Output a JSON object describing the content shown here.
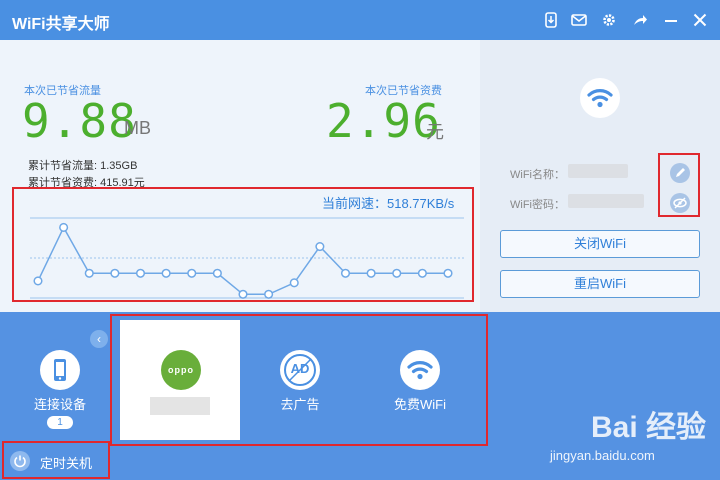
{
  "app": {
    "title": "WiFi共享大师"
  },
  "titlebar": {
    "icons": [
      "download-icon",
      "mail-icon",
      "gear-icon",
      "share-icon",
      "minimize-icon",
      "close-icon"
    ]
  },
  "savings": {
    "traffic_label": "本次已节省流量",
    "traffic_value": "9.88",
    "traffic_unit": "MB",
    "cost_label": "本次已节省资费",
    "cost_value": "2.96",
    "cost_unit": "元",
    "total_traffic": "累计节省流量: 1.35GB",
    "total_cost": "累计节省资费: 415.91元"
  },
  "speed": {
    "text": "当前网速：518.77KB/s"
  },
  "chart_data": {
    "type": "line",
    "x": [
      1,
      2,
      3,
      4,
      5,
      6,
      7,
      8,
      9,
      10,
      11,
      12,
      13,
      14,
      15,
      16,
      17
    ],
    "values": [
      0.4,
      3.2,
      0.8,
      0.8,
      0.8,
      0.8,
      0.8,
      0.8,
      -0.3,
      -0.3,
      0.3,
      2.2,
      0.8,
      0.8,
      0.8,
      0.8,
      0.8
    ],
    "ylim": [
      -0.6,
      3.8
    ],
    "grid": false,
    "color": "#6fa8e6"
  },
  "wifi_info": {
    "name_label": "WiFi名称：",
    "password_label": "WiFi密码："
  },
  "buttons": {
    "close_wifi": "关闭WiFi",
    "restart_wifi": "重启WiFi"
  },
  "bottom": {
    "connected_label": "连接设备",
    "connected_count": "1",
    "oppo_logo_text": "oppo",
    "ad_label": "去广告",
    "free_wifi_label": "免费WiFi",
    "ad_icon_text": "AD",
    "shutdown_label": "定时关机",
    "collapse_glyph": "‹"
  },
  "watermark": {
    "brand": "Bai 经验",
    "url": "jingyan.baidu.com"
  },
  "colors": {
    "accent": "#4a90e2",
    "green": "#4caf2e",
    "highlight": "#e0282e"
  }
}
